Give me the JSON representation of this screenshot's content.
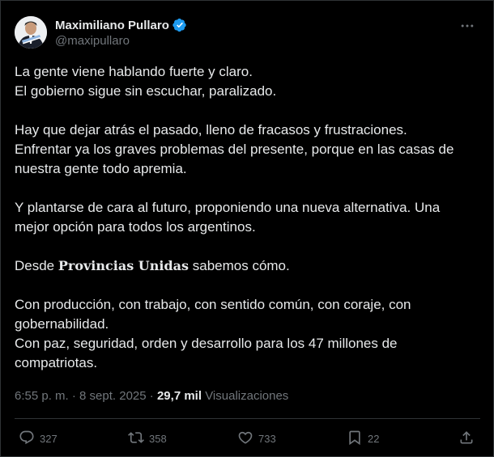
{
  "author": {
    "display_name": "Maximiliano Pullaro",
    "handle": "@maxipullaro",
    "verified_color": "#1d9bf0"
  },
  "tweet": {
    "paragraphs": [
      {
        "lines": [
          "La gente viene hablando fuerte y claro.",
          "El gobierno sigue sin escuchar, paralizado."
        ]
      },
      {
        "lines": [
          "Hay que dejar atrás el pasado, lleno de fracasos y frustraciones.",
          "Enfrentar ya los graves problemas del presente, porque en las casas de",
          "nuestra gente todo apremia."
        ]
      },
      {
        "lines": [
          "Y plantarse de cara al futuro, proponiendo una nueva alternativa. Una",
          "mejor opción para todos los argentinos."
        ]
      }
    ],
    "special_line": {
      "before": "Desde ",
      "bold": "Provincias Unidas",
      "after": " sabemos cómo."
    },
    "closing": {
      "lines": [
        "Con producción, con trabajo, con sentido común, con coraje, con",
        "gobernabilidad.",
        "Con paz, seguridad, orden y desarrollo para los 47 millones de",
        "compatriotas."
      ]
    }
  },
  "meta": {
    "time": "6:55 p. m.",
    "separator": " · ",
    "date": "8 sept. 2025",
    "views_count": "29,7 mil",
    "views_label": "Visualizaciones"
  },
  "actions": {
    "replies": "327",
    "reposts": "358",
    "likes": "733",
    "bookmarks": "22"
  },
  "icons": {
    "more": "more-icon",
    "reply": "reply-icon",
    "repost": "repost-icon",
    "like": "like-icon",
    "bookmark": "bookmark-icon",
    "share": "share-icon",
    "verified": "verified-badge-icon"
  },
  "colors": {
    "background": "#000000",
    "text": "#e7e9ea",
    "muted": "#71767b",
    "border": "#2f3336",
    "verified": "#1d9bf0"
  }
}
